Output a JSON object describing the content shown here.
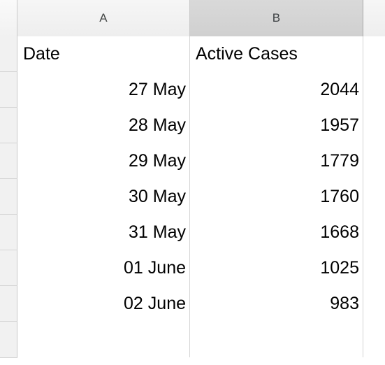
{
  "app": {
    "type": "spreadsheet"
  },
  "column_headers": [
    {
      "label": "A",
      "selected": false
    },
    {
      "label": "B",
      "selected": true
    },
    {
      "label": "",
      "selected": false
    }
  ],
  "table": {
    "header_row": {
      "col_a": "Date",
      "col_b": "Active Cases"
    },
    "rows": [
      {
        "col_a": "27 May",
        "col_b": "2044"
      },
      {
        "col_a": "28 May",
        "col_b": "1957"
      },
      {
        "col_a": "29 May",
        "col_b": "1779"
      },
      {
        "col_a": "30 May",
        "col_b": "1760"
      },
      {
        "col_a": "31 May",
        "col_b": "1668"
      },
      {
        "col_a": "01 June",
        "col_b": "1025"
      },
      {
        "col_a": "02 June",
        "col_b": "983"
      },
      {
        "col_a": "",
        "col_b": ""
      }
    ]
  },
  "colors": {
    "header_default": "#eeeeee",
    "header_selected": "#d3d3d3",
    "gridline": "#d4d4d4",
    "cell_background": "#ffffff",
    "text": "#000000"
  }
}
